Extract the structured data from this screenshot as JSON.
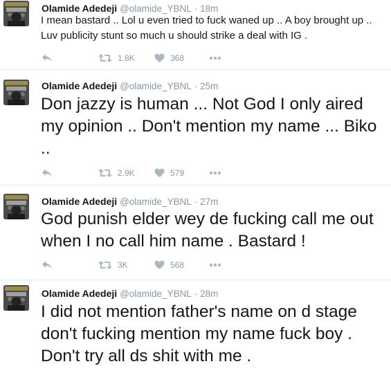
{
  "tweets": [
    {
      "name": "Olamide Adedeji",
      "handle": "@olamide_YBNL",
      "separator": "·",
      "time": "18m",
      "text": "I mean bastard .. Lol u even tried to fuck waned up .. A boy brought up .. Luv publicity stunt so much u should strike a deal with IG .",
      "retweets": "1.8K",
      "likes": "368"
    },
    {
      "name": "Olamide Adedeji",
      "handle": "@olamide_YBNL",
      "separator": "·",
      "time": "25m",
      "text": "Don jazzy is human ... Not God I only aired my opinion .. Don't mention my name ... Biko ..",
      "retweets": "2.9K",
      "likes": "579"
    },
    {
      "name": "Olamide Adedeji",
      "handle": "@olamide_YBNL",
      "separator": "·",
      "time": "27m",
      "text": "God punish elder wey de fucking call me out when I no call him name . Bastard !",
      "retweets": "3K",
      "likes": "568"
    },
    {
      "name": "Olamide Adedeji",
      "handle": "@olamide_YBNL",
      "separator": "·",
      "time": "28m",
      "text": "I did not mention father's name on d stage don't fucking mention my name fuck boy . Don't try all ds shit with me ."
    }
  ],
  "colors": {
    "icon_gray": "#aab8c2",
    "meta_gray": "#8899a6",
    "divider": "#e6ecf0",
    "text": "#14171a"
  },
  "icons": [
    "reply-icon",
    "retweet-icon",
    "heart-icon",
    "more-icon"
  ]
}
